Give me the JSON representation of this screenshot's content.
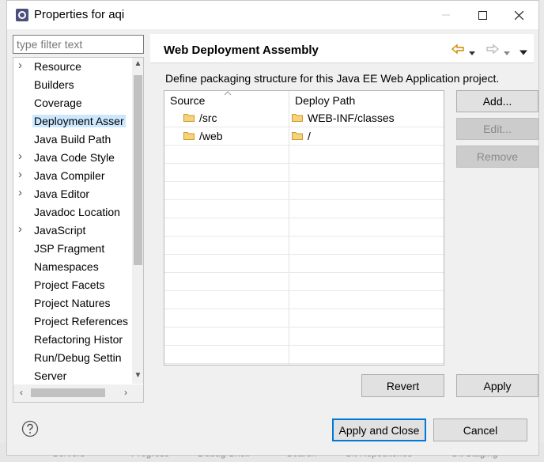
{
  "window": {
    "title": "Properties for aqi"
  },
  "filter": {
    "placeholder": "type filter text"
  },
  "tree": {
    "items": [
      {
        "label": "Resource",
        "expandable": true
      },
      {
        "label": "Builders",
        "expandable": false
      },
      {
        "label": "Coverage",
        "expandable": false
      },
      {
        "label": "Deployment Asser",
        "expandable": false,
        "selected": true
      },
      {
        "label": "Java Build Path",
        "expandable": false
      },
      {
        "label": "Java Code Style",
        "expandable": true
      },
      {
        "label": "Java Compiler",
        "expandable": true
      },
      {
        "label": "Java Editor",
        "expandable": true
      },
      {
        "label": "Javadoc Location",
        "expandable": false
      },
      {
        "label": "JavaScript",
        "expandable": true
      },
      {
        "label": "JSP Fragment",
        "expandable": false
      },
      {
        "label": "Namespaces",
        "expandable": false
      },
      {
        "label": "Project Facets",
        "expandable": false
      },
      {
        "label": "Project Natures",
        "expandable": false
      },
      {
        "label": "Project References",
        "expandable": false
      },
      {
        "label": "Refactoring Histor",
        "expandable": false
      },
      {
        "label": "Run/Debug Settin",
        "expandable": false
      },
      {
        "label": "Server",
        "expandable": false
      }
    ]
  },
  "page": {
    "title": "Web Deployment Assembly",
    "description": "Define packaging structure for this Java EE Web Application project."
  },
  "table": {
    "headers": {
      "source": "Source",
      "deploy": "Deploy Path"
    },
    "rows": [
      {
        "source": "/src",
        "deploy": "WEB-INF/classes"
      },
      {
        "source": "/web",
        "deploy": "/"
      }
    ]
  },
  "buttons": {
    "add": "Add...",
    "edit": "Edit...",
    "remove": "Remove",
    "revert": "Revert",
    "apply": "Apply",
    "apply_close": "Apply and Close",
    "cancel": "Cancel"
  },
  "background_tabs": [
    "Servers",
    "Progress",
    "Debug Shell",
    "Search",
    "Git Repositories",
    "Git Staging"
  ]
}
